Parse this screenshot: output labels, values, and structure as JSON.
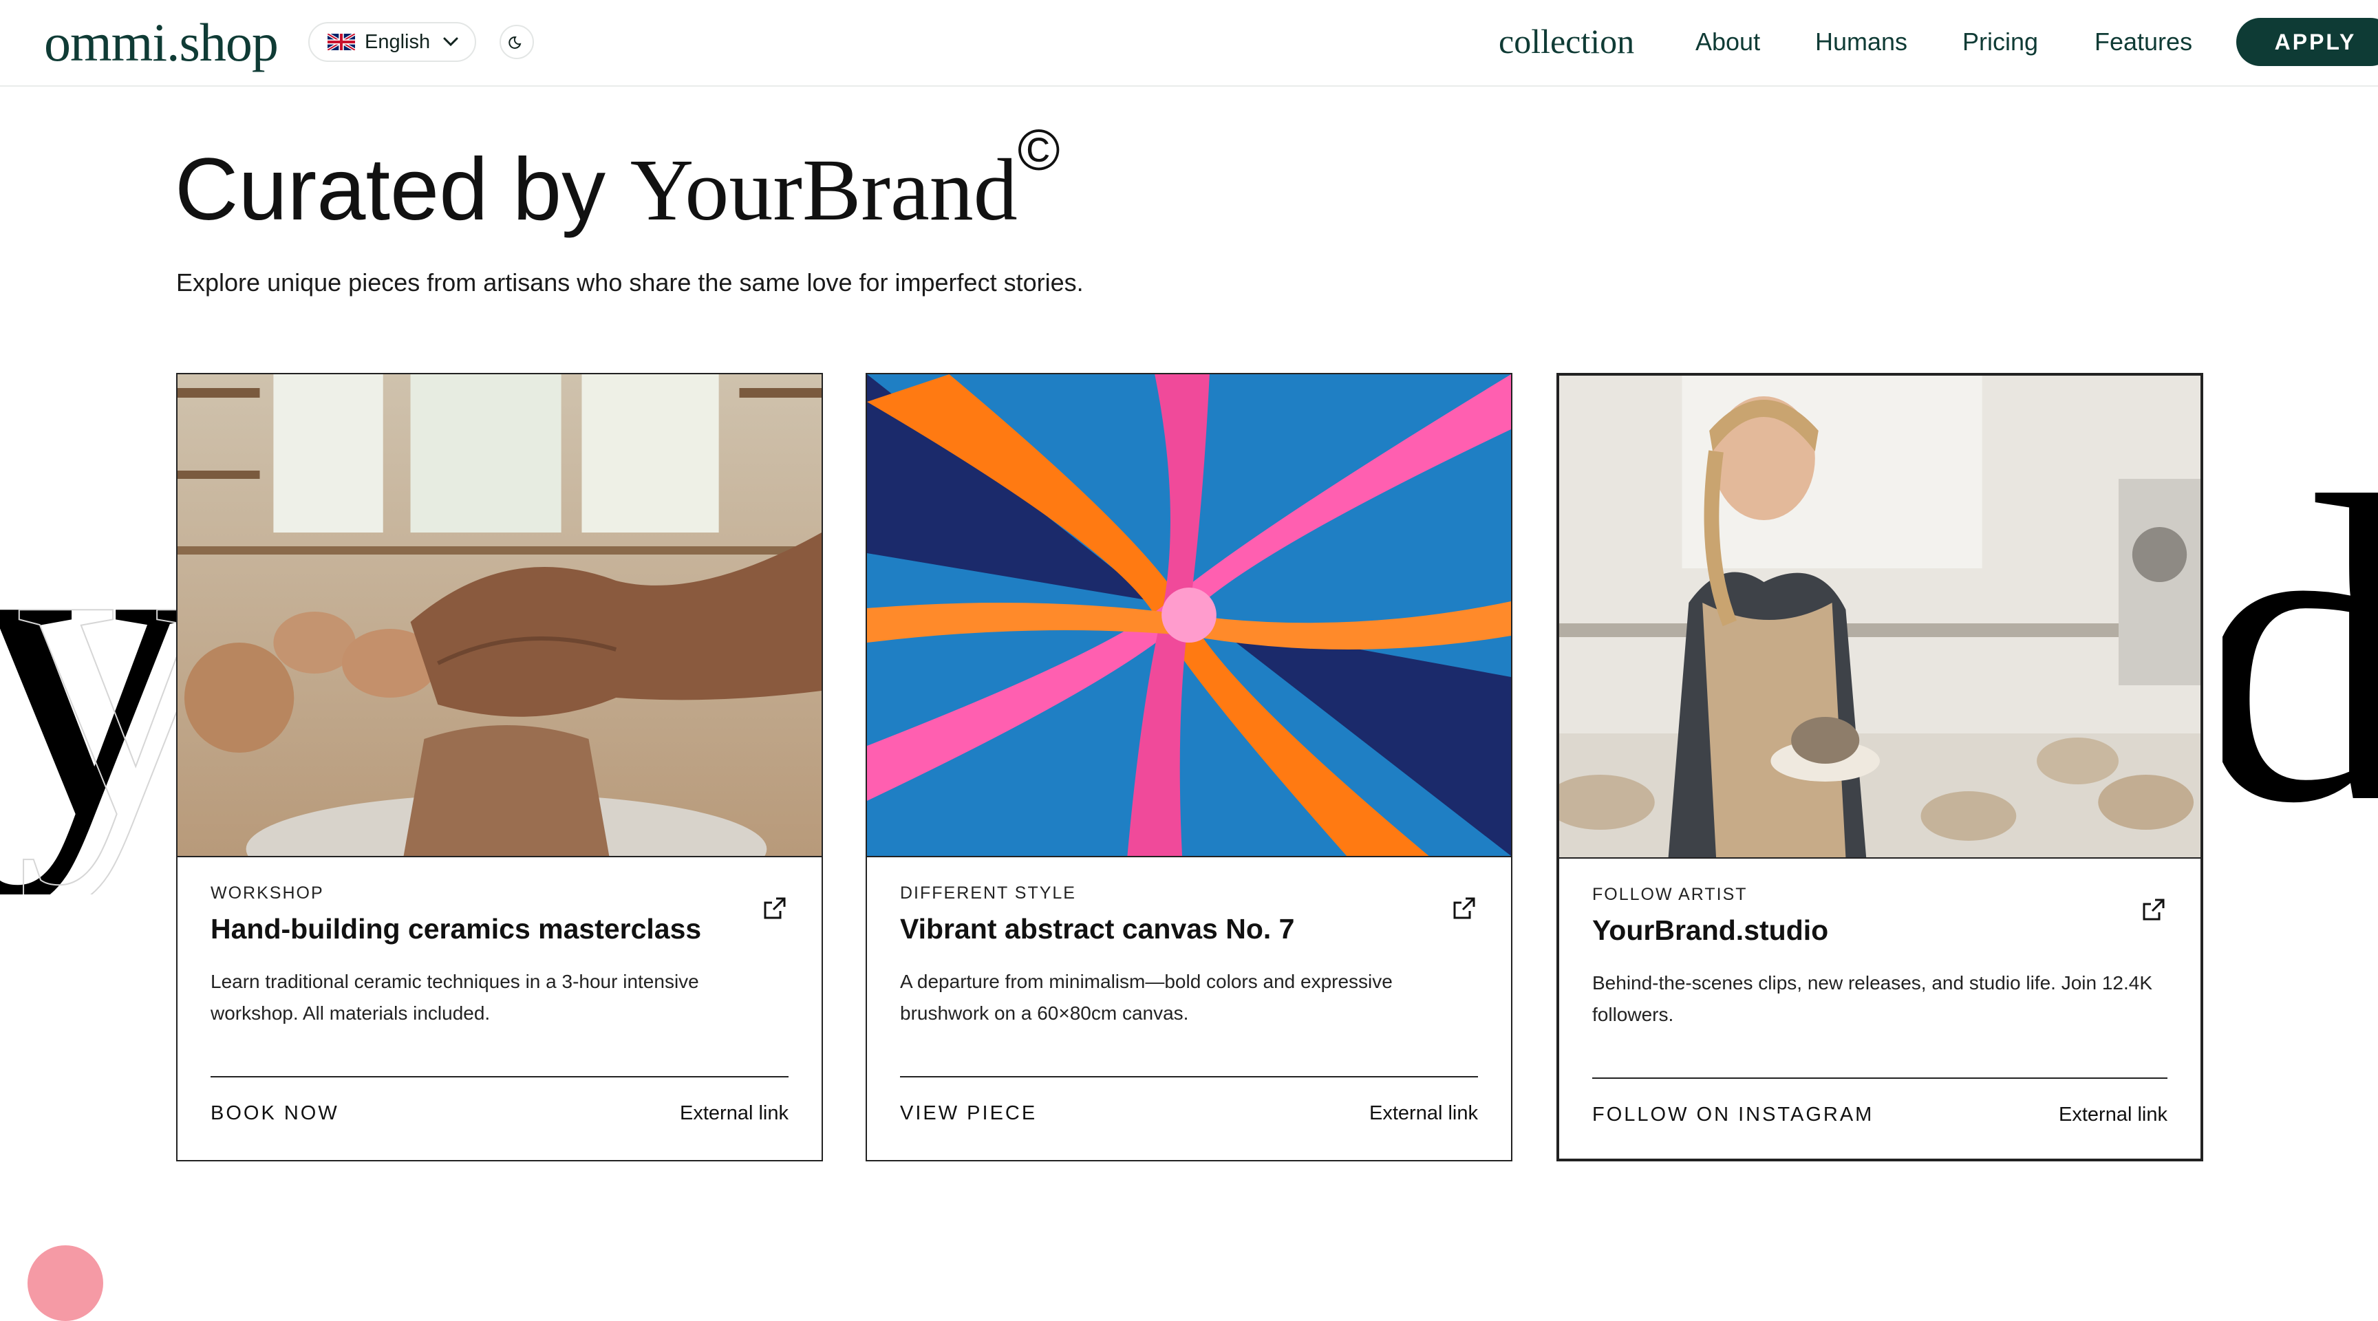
{
  "header": {
    "logo": "ommi.shop",
    "language": {
      "label": "English",
      "flag": "uk-flag-icon"
    },
    "theme_toggle": {
      "icon": "moon-icon"
    },
    "nav": [
      {
        "label": "collection",
        "style": "serif"
      },
      {
        "label": "About"
      },
      {
        "label": "Humans"
      },
      {
        "label": "Pricing"
      },
      {
        "label": "Features"
      }
    ],
    "cta": "APPLY"
  },
  "hero": {
    "title_prefix": "Curated by",
    "title_brand": "YourBrand",
    "title_mark": "©",
    "subtitle": "Explore unique pieces from artisans who share the same love for imperfect stories."
  },
  "cards": [
    {
      "tag": "WORKSHOP",
      "title": "Hand-building ceramics masterclass",
      "description": "Learn traditional ceramic techniques in a 3-hour intensive workshop. All materials included.",
      "cta": "BOOK NOW",
      "link_label": "External link",
      "image": "pottery-wheel-hands-photo"
    },
    {
      "tag": "DIFFERENT STYLE",
      "title": "Vibrant abstract canvas No. 7",
      "description": "A departure from minimalism—bold colors and expressive brushwork on a 60×80cm canvas.",
      "cta": "VIEW PIECE",
      "link_label": "External link",
      "image": "abstract-swirl-painting"
    },
    {
      "tag": "FOLLOW ARTIST",
      "title": "YourBrand.studio",
      "description": "Behind-the-scenes clips, new releases, and studio life. Join 12.4K followers.",
      "cta": "FOLLOW ON INSTAGRAM",
      "link_label": "External link",
      "image": "artist-in-studio-photo"
    }
  ],
  "colors": {
    "brand_green": "#0e3b35",
    "text": "#111111",
    "border": "#222222"
  }
}
